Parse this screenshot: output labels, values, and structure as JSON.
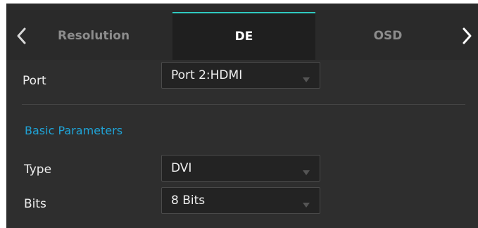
{
  "tabs": {
    "prev_icon": "chevron-left-icon",
    "next_icon": "chevron-right-icon",
    "items": [
      {
        "label": "Resolution",
        "active": false
      },
      {
        "label": "DE",
        "active": true
      },
      {
        "label": "OSD",
        "active": false
      }
    ],
    "active_indicator_color": "#2fc9c0"
  },
  "port": {
    "label": "Port",
    "value": "Port 2:HDMI"
  },
  "basic_parameters": {
    "title": "Basic Parameters",
    "title_color": "#1fa3d6",
    "type": {
      "label": "Type",
      "value": "DVI"
    },
    "bits": {
      "label": "Bits",
      "value": "8 Bits"
    }
  },
  "dropdown_icon": "caret-down-icon"
}
